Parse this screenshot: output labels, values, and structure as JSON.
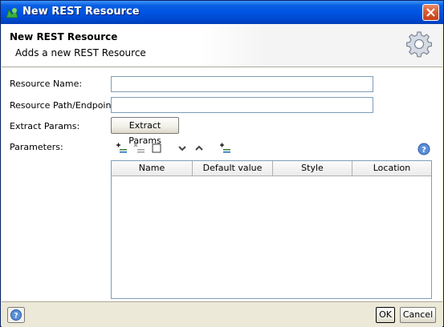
{
  "window": {
    "title": "New REST Resource",
    "accent": "#0054e3"
  },
  "header": {
    "title": "New REST Resource",
    "description": "Adds a new REST Resource",
    "icon": "gear-icon"
  },
  "form": {
    "resource_name_label": "Resource Name:",
    "resource_name_value": "",
    "resource_path_label": "Resource Path/Endpoint:",
    "resource_path_value": "",
    "extract_params_label": "Extract Params:",
    "extract_params_button": "Extract Params",
    "parameters_label": "Parameters:"
  },
  "toolbar": {
    "icons": [
      "add-param-icon",
      "remove-param-icon",
      "clear-icon",
      "move-down-icon",
      "move-up-icon",
      "add-from-uri-icon",
      "help-icon"
    ]
  },
  "table": {
    "columns": [
      "Name",
      "Default value",
      "Style",
      "Location"
    ],
    "rows": []
  },
  "footer": {
    "ok_label": "OK",
    "cancel_label": "Cancel"
  }
}
